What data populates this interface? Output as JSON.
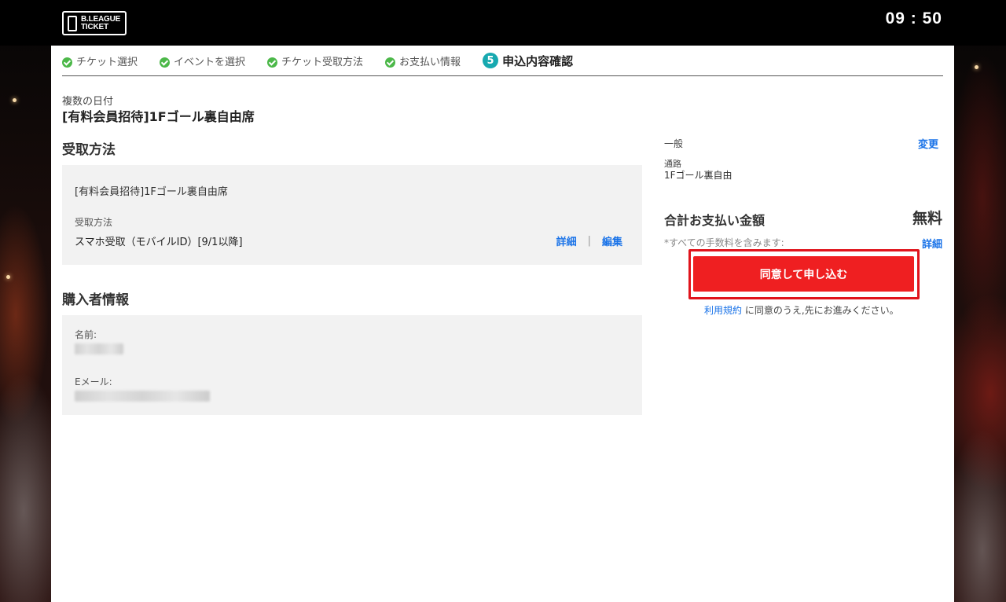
{
  "header": {
    "logo_line1": "B.LEAGUE",
    "logo_line2": "TICKET",
    "time": "09 : 50"
  },
  "steps": [
    {
      "label": "チケット選択",
      "done": true
    },
    {
      "label": "イベントを選択",
      "done": true
    },
    {
      "label": "チケット受取方法",
      "done": true
    },
    {
      "label": "お支払い情報",
      "done": true
    },
    {
      "label": "申込内容確認",
      "number": "5",
      "active": true
    }
  ],
  "event": {
    "date_label": "複数の日付",
    "title": "[有料会員招待]1Fゴール裏自由席"
  },
  "receive": {
    "section_title": "受取方法",
    "seat": "[有料会員招待]1Fゴール裏自由席",
    "method_label": "受取方法",
    "method_value": "スマホ受取（モバイルID）[9/1以降]",
    "detail_link": "詳細",
    "separator": "|",
    "edit_link": "編集"
  },
  "buyer": {
    "section_title": "購入者情報",
    "name_label": "名前:",
    "email_label": "Eメール:"
  },
  "summary": {
    "ticket_type": "一般",
    "change_link": "変更",
    "aisle_label": "通路",
    "seat_name": "1Fゴール裏自由",
    "total_label": "合計お支払い金額",
    "total_value": "無料",
    "fee_note": "*すべての手数料を含みます:",
    "fee_detail_link": "詳細",
    "apply_button": "同意して申し込む",
    "terms_link": "利用規約",
    "terms_text": "に同意のうえ,先にお進みください。"
  },
  "colors": {
    "accent_teal": "#17a9b0",
    "check_green": "#4cb849",
    "apply_red": "#ef1f21",
    "link_blue": "#1a73e8"
  }
}
